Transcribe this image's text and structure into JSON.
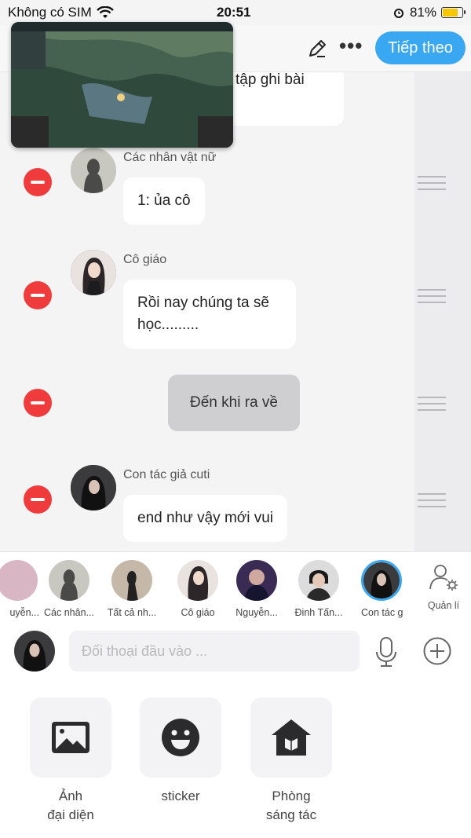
{
  "status_bar": {
    "carrier": "Không có SIM",
    "time": "20:51",
    "battery": "81%",
    "battery_level": 0.81
  },
  "header": {
    "next_label": "Tiếp theo",
    "icons": [
      "pencil-icon",
      "more-icon"
    ]
  },
  "messages": [
    {
      "name": "",
      "text": "tập ghi bài",
      "type": "left"
    },
    {
      "name": "Các nhân vật nữ",
      "text": "1: ủa cô",
      "type": "left"
    },
    {
      "name": "Cô giáo",
      "text": "Rồi nay chúng ta sẽ học.........",
      "type": "left"
    },
    {
      "name": "",
      "text": "Đến khi ra về",
      "type": "narration"
    },
    {
      "name": "Con tác giả cuti",
      "text": "end như vậy mới vui",
      "type": "left"
    }
  ],
  "characters": [
    {
      "name": "uyễn..."
    },
    {
      "name": "Các nhân..."
    },
    {
      "name": "Tất cả nh..."
    },
    {
      "name": "Cô giáo"
    },
    {
      "name": "Nguyễn..."
    },
    {
      "name": "Đinh Tấn..."
    },
    {
      "name": "Con tác g"
    }
  ],
  "manage_label": "Quản lí",
  "input": {
    "placeholder": "Đối thoại đầu vào ..."
  },
  "tools": [
    {
      "label": "Ảnh\nđại diện",
      "icon": "image-icon"
    },
    {
      "label": "sticker",
      "icon": "smiley-icon"
    },
    {
      "label": "Phòng\nsáng tác",
      "icon": "house-icon"
    }
  ]
}
